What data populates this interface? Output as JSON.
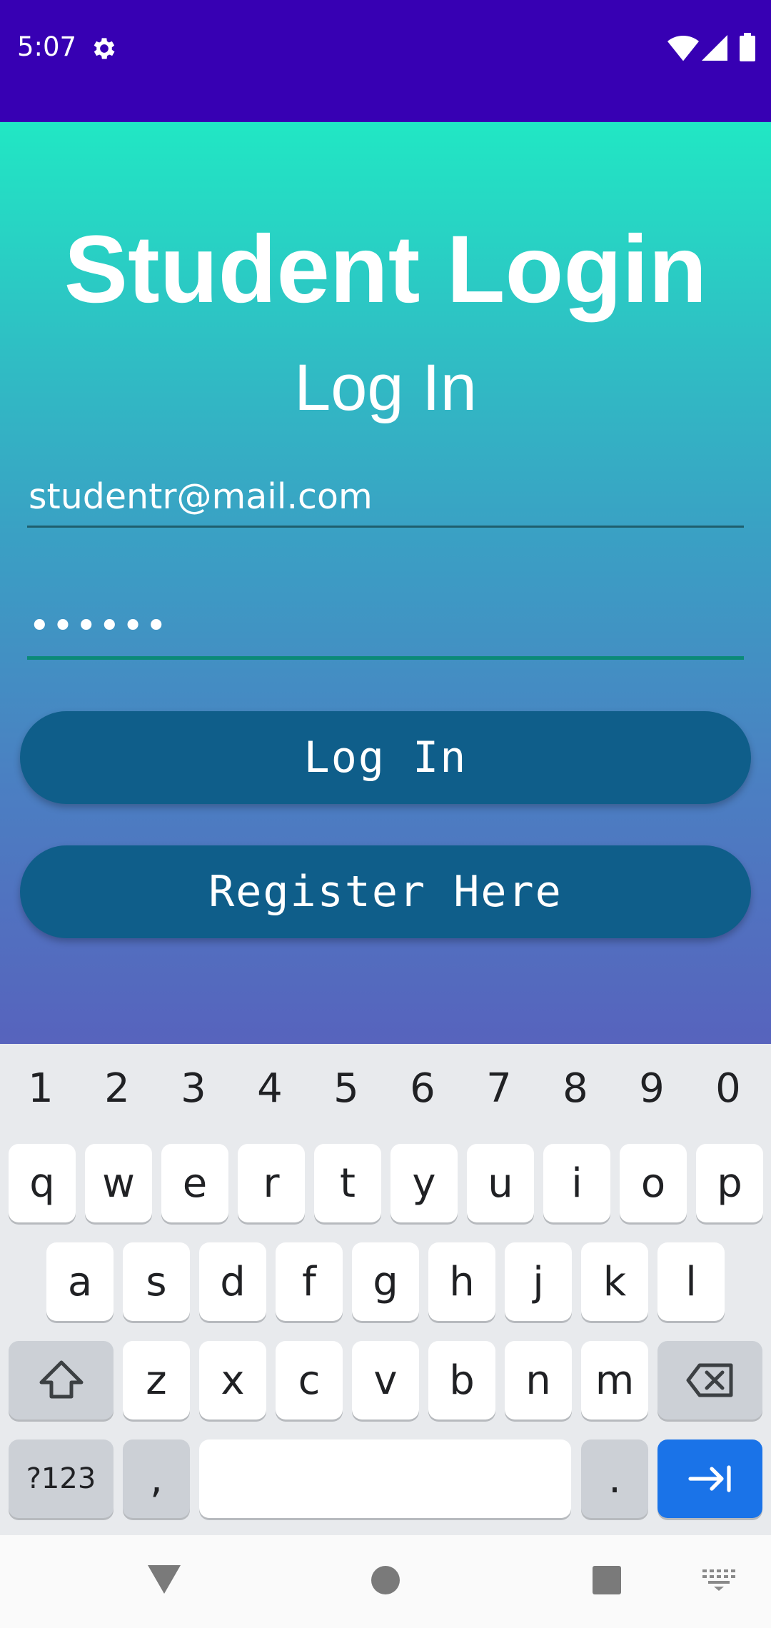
{
  "status_bar": {
    "time": "5:07",
    "icons": [
      "gear-icon",
      "wifi-icon",
      "signal-icon",
      "battery-icon"
    ],
    "background": "#3700b3"
  },
  "app": {
    "title": "Student Login",
    "subtitle": "Log In",
    "email_value": "studentr@mail.com",
    "password_mask": "••••••",
    "login_button": "Log In",
    "register_button": "Register Here",
    "button_color": "#0f5e8a"
  },
  "keyboard": {
    "number_row": [
      "1",
      "2",
      "3",
      "4",
      "5",
      "6",
      "7",
      "8",
      "9",
      "0"
    ],
    "row1": [
      "q",
      "w",
      "e",
      "r",
      "t",
      "y",
      "u",
      "i",
      "o",
      "p"
    ],
    "row2": [
      "a",
      "s",
      "d",
      "f",
      "g",
      "h",
      "j",
      "k",
      "l"
    ],
    "row3": [
      "z",
      "x",
      "c",
      "v",
      "b",
      "n",
      "m"
    ],
    "symbols_key": "?123",
    "comma_key": ",",
    "period_key": ".",
    "icons": [
      "shift-icon",
      "backspace-icon",
      "tab-arrow-icon"
    ],
    "action_color": "#1a73e8"
  },
  "nav_bar": {
    "icons": [
      "back-icon",
      "home-icon",
      "recents-icon",
      "keyboard-icon"
    ]
  }
}
